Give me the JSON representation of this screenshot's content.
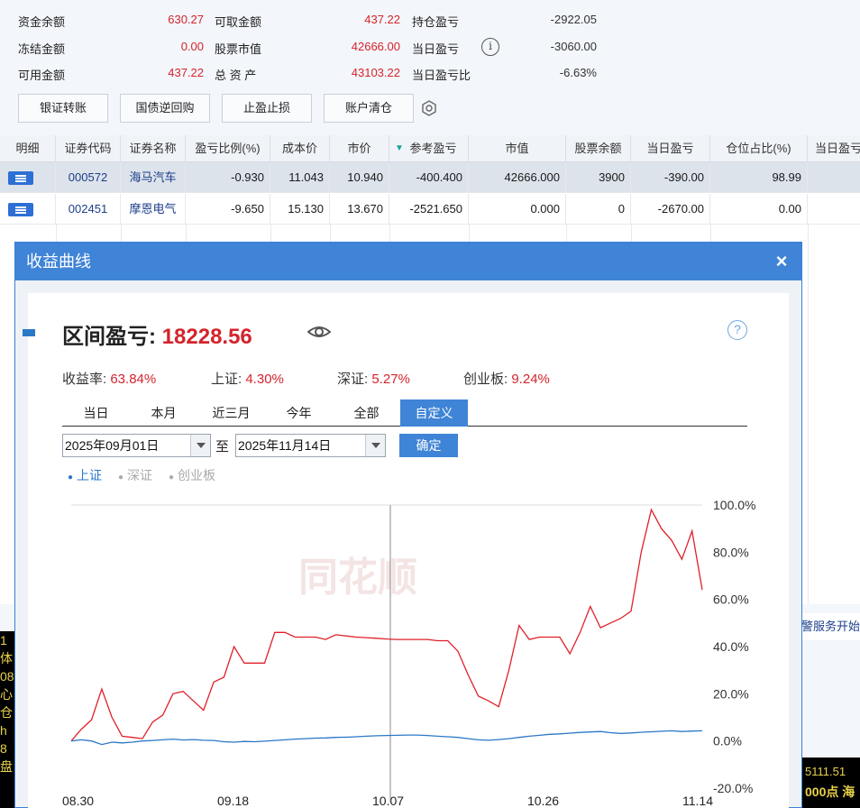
{
  "account": {
    "capital_balance": {
      "label": "资金余额",
      "value": "630.27"
    },
    "withdrawable": {
      "label": "可取金额",
      "value": "437.22"
    },
    "position_pnl": {
      "label": "持仓盈亏",
      "value": "-2922.05"
    },
    "frozen": {
      "label": "冻结金额",
      "value": "0.00"
    },
    "stock_value": {
      "label": "股票市值",
      "value": "42666.00"
    },
    "daily_pnl": {
      "label": "当日盈亏",
      "value": "-3060.00"
    },
    "available": {
      "label": "可用金额",
      "value": "437.22"
    },
    "total_assets": {
      "label": "总 资 产",
      "value": "43103.22"
    },
    "daily_pnl_ratio": {
      "label": "当日盈亏比",
      "value": "-6.63%"
    }
  },
  "toolbar": {
    "bank_transfer": "银证转账",
    "bond_repo": "国债逆回购",
    "take_profit_stop_loss": "止盈止损",
    "clear_account": "账户清仓"
  },
  "table": {
    "headers": [
      "明细",
      "证券代码",
      "证券名称",
      "盈亏比例(%)",
      "成本价",
      "市价",
      "参考盈亏",
      "市值",
      "股票余额",
      "当日盈亏",
      "仓位占比(%)",
      "当日盈亏"
    ],
    "rows": [
      {
        "code": "000572",
        "name": "海马汽车",
        "pnl_ratio": "-0.930",
        "cost": "11.043",
        "price": "10.940",
        "ref_pnl": "-400.400",
        "market_value": "42666.000",
        "balance": "3900",
        "daily_pnl": "-390.00",
        "position_ratio": "98.99"
      },
      {
        "code": "002451",
        "name": "摩恩电气",
        "pnl_ratio": "-9.650",
        "cost": "15.130",
        "price": "13.670",
        "ref_pnl": "-2521.650",
        "market_value": "0.000",
        "balance": "0",
        "daily_pnl": "-2670.00",
        "position_ratio": "0.00"
      }
    ]
  },
  "background": {
    "left_chars": [
      "1",
      "体",
      "08",
      "心",
      "仓",
      "h",
      "8",
      "盘"
    ],
    "right_text": "警服务开始",
    "right_bottom1": "5111.51",
    "right_bottom2": "000点 海"
  },
  "dialog": {
    "title": "收益曲线",
    "close": "×",
    "range_label": "区间盈亏:",
    "range_value": "18228.56",
    "help": "?",
    "stats": [
      {
        "label": "收益率:",
        "value": "63.84%"
      },
      {
        "label": "上证:",
        "value": "4.30%"
      },
      {
        "label": "深证:",
        "value": "5.27%"
      },
      {
        "label": "创业板:",
        "value": "9.24%"
      }
    ],
    "tabs": [
      "当日",
      "本月",
      "近三月",
      "今年",
      "全部",
      "自定义"
    ],
    "active_tab": "自定义",
    "start_date": "2025年09月01日",
    "to_label": "至",
    "end_date": "2025年11月14日",
    "confirm": "确定",
    "legend": [
      {
        "label": "上证",
        "color": "#2a78c8"
      },
      {
        "label": "深证",
        "color": "#aaaaaa"
      },
      {
        "label": "创业板",
        "color": "#aaaaaa"
      }
    ]
  },
  "chart_data": {
    "type": "line",
    "x_ticks": [
      "08.30",
      "09.18",
      "10.07",
      "10.26",
      "11.14"
    ],
    "y_ticks": [
      "100.0%",
      "80.0%",
      "60.0%",
      "40.0%",
      "20.0%",
      "0.0%",
      "-20.0%"
    ],
    "ylim": [
      -20,
      100
    ],
    "series": [
      {
        "name": "收益率",
        "color": "#e0202a",
        "values": [
          0,
          5,
          9,
          22,
          10,
          2,
          1.5,
          1,
          8,
          11,
          20,
          21,
          17,
          13,
          25,
          27,
          40,
          33,
          33,
          33,
          46,
          46,
          44,
          44,
          44,
          43,
          45,
          44.5,
          44,
          43.8,
          43.5,
          43.2,
          43,
          43,
          43,
          43,
          42.5,
          42.5,
          38,
          28,
          19,
          17,
          14.5,
          30,
          49,
          43,
          44,
          44,
          44,
          37,
          46,
          57,
          48,
          50,
          52,
          55,
          80,
          98,
          90,
          85,
          77,
          89,
          64
        ]
      },
      {
        "name": "上证",
        "color": "#2a78c8",
        "values": [
          0,
          0.5,
          0,
          -1.5,
          -0.5,
          -0.8,
          -0.5,
          0,
          0.2,
          0.5,
          0.8,
          0.4,
          0.6,
          0.3,
          0.2,
          -0.3,
          -0.5,
          -0.2,
          -0.3,
          -0.1,
          0.2,
          0.5,
          0.8,
          1.0,
          1.2,
          1.3,
          1.5,
          1.6,
          1.8,
          2.0,
          2.2,
          2.3,
          2.4,
          2.5,
          2.5,
          2.3,
          2.0,
          1.8,
          1.5,
          1.0,
          0.5,
          0.3,
          0.6,
          1.0,
          1.5,
          2.0,
          2.4,
          2.8,
          3.0,
          3.3,
          3.6,
          3.8,
          4.0,
          3.5,
          3.2,
          3.4,
          3.7,
          3.9,
          4.1,
          4.3,
          4.0,
          4.2,
          4.3
        ]
      }
    ],
    "vertical_marker_x": "10.07",
    "watermark": "同花顺"
  }
}
